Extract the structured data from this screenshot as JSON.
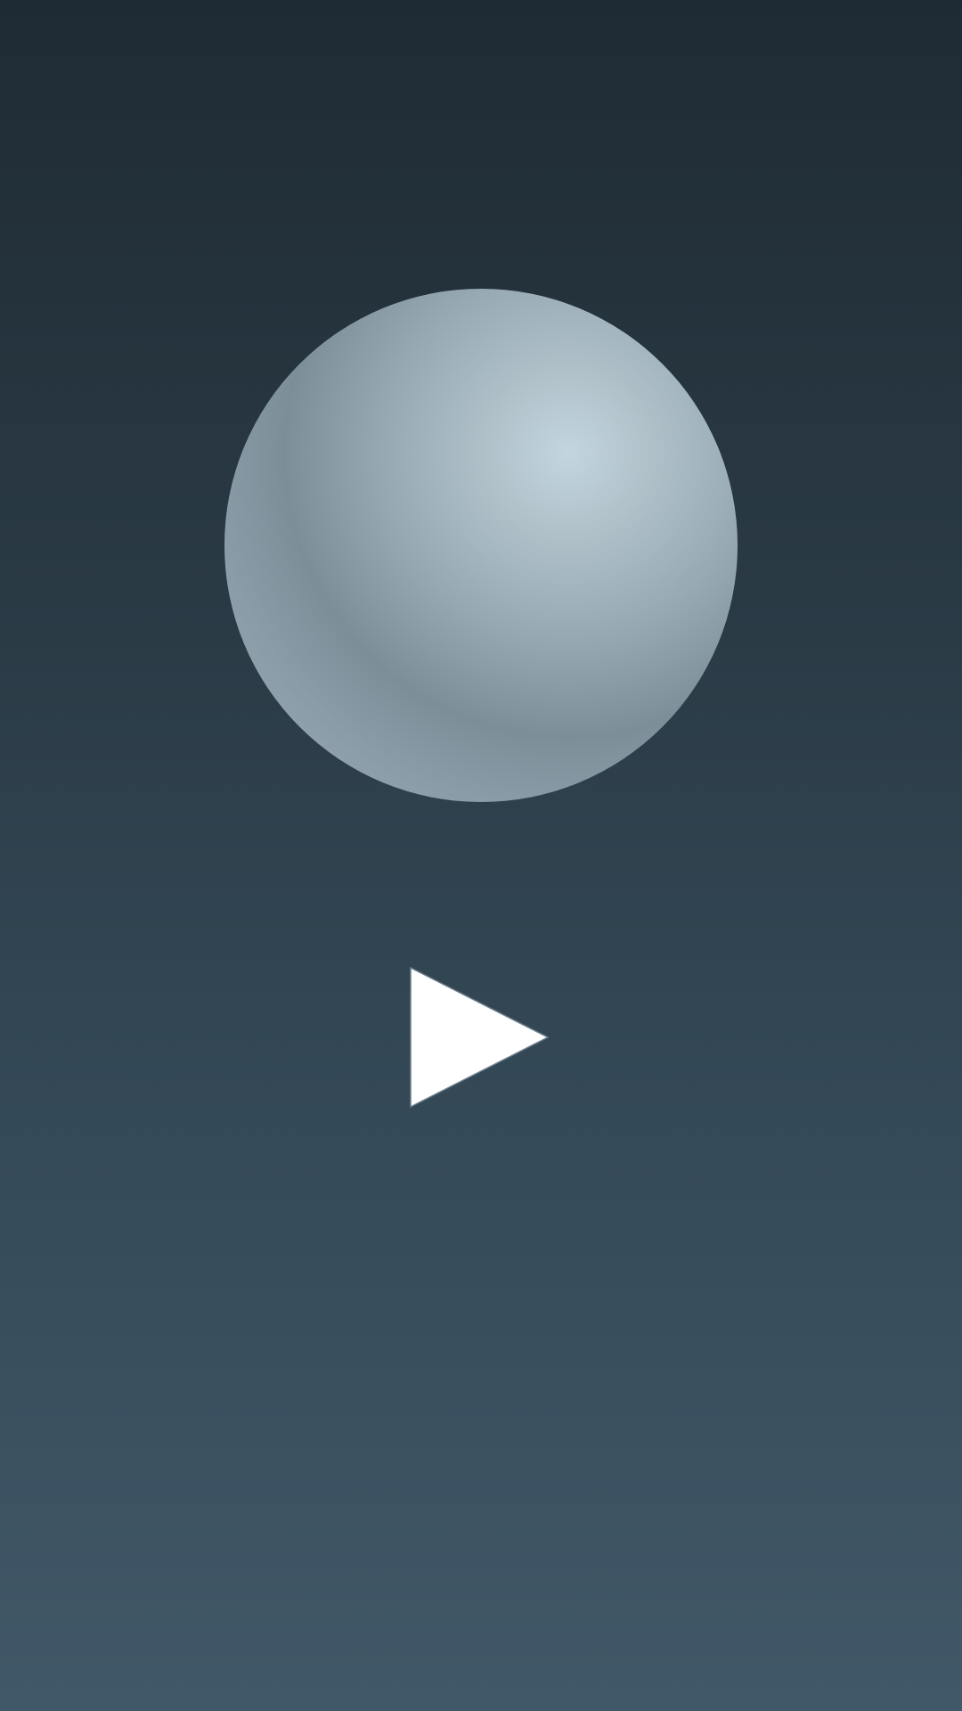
{
  "scene": {
    "background_top": "#1f2b34",
    "background_bottom": "#415868",
    "sphere_highlight": "#c3d5de",
    "sphere_shadow": "#7c8f99"
  },
  "controls": {
    "play": {
      "icon": "play-icon",
      "color": "#ffffff"
    }
  }
}
